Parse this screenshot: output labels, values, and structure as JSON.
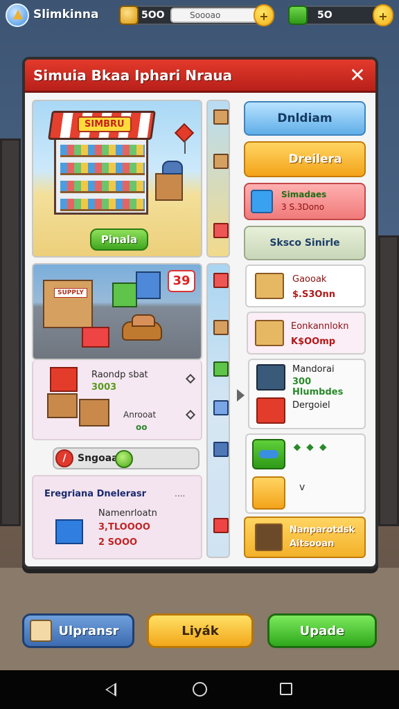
{
  "topbar": {
    "app_title": "Slimkinna",
    "coins_value": "5OO",
    "search_value": "Soooao",
    "cash_value": "5O",
    "plus_label": "+",
    "colors": {
      "coin": "#f2b21a",
      "cash": "#3fa61f"
    }
  },
  "dialog": {
    "title": "Simuia Bkaa Iphari Nraua",
    "close_label": "✕",
    "store": {
      "sign": "SIMBRU",
      "button_label": "Pinala"
    },
    "warehouse": {
      "counter": "39",
      "sign": "SUPPLY"
    },
    "order": {
      "line1": "Raondp sbat",
      "line2": "3003",
      "line3": "Anrooat",
      "line4": "oo"
    },
    "slider": {
      "label": "Sngoaa"
    },
    "stats": {
      "title": "Eregriana Dnelerasr",
      "dots": "....",
      "line1": "Namenrloatn",
      "line2": "3,TLOOOO",
      "line3": "2 SOOO"
    },
    "right": {
      "btn_blue": "Dnldiam",
      "btn_yellow": "Dreilera",
      "btn_pink_line1": "Simadaes",
      "btn_pink_line2": "3 S.3Dono",
      "btn_grey": "Sksco Sinirle",
      "card1_line1": "Gaooak",
      "card1_line2": "$.S3Onn",
      "card2_line1": "Eonkannlokn",
      "card2_line2": "K$OOmp",
      "card3_line1": "Mandorai",
      "card3_line2": "300 Hlumbdes",
      "card3_line3": "Dergoiel",
      "card4_gems": "⬥ ⬥ ⬥",
      "card4_check": "v",
      "card5_line1": "Nanparotdsk",
      "card5_line2": "Aitsooan"
    }
  },
  "bottom": {
    "btn_left": "Ulpransr",
    "btn_mid": "Liyák",
    "btn_right": "Upade"
  },
  "icons": [
    "avatar-icon",
    "coin-icon",
    "cash-icon",
    "close-icon",
    "box-icon",
    "gem-icon",
    "back-icon",
    "home-icon",
    "recent-apps-icon"
  ]
}
